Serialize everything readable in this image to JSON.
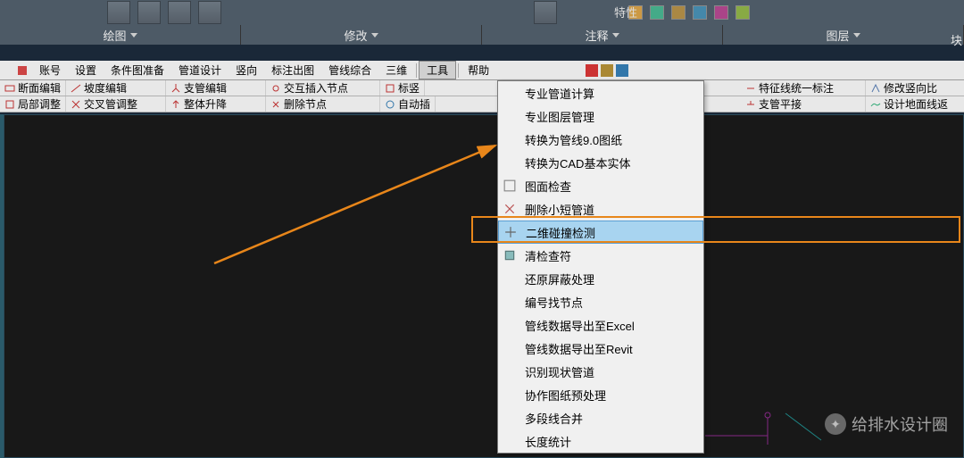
{
  "props_label": "特性",
  "category": {
    "c1": "绘图",
    "c2": "修改",
    "c3": "注释",
    "c4": "图层",
    "c5": "块"
  },
  "menu": {
    "m1": "账号",
    "m2": "设置",
    "m3": "条件图准备",
    "m4": "管道设计",
    "m5": "竖向",
    "m6": "标注出图",
    "m7": "管线综合",
    "m8": "三维",
    "m9": "工具",
    "m10": "帮助"
  },
  "toolbar1": {
    "t1": "断面编辑",
    "t2": "坡度编辑",
    "t3": "支管编辑",
    "t4": "交互插入节点",
    "t5": "标竖",
    "t6": "特征线统一标注",
    "t7": "修改竖向比"
  },
  "toolbar2": {
    "t1": "局部调整",
    "t2": "交叉管调整",
    "t3": "整体升降",
    "t4": "删除节点",
    "t5": "自动插",
    "t6": "支管平接",
    "t7": "设计地面线返"
  },
  "dropdown": {
    "d1": "专业管道计算",
    "d2": "专业图层管理",
    "d3": "转换为管线9.0图纸",
    "d4": "转换为CAD基本实体",
    "d5": "图面检查",
    "d6": "删除小短管道",
    "d7": "二维碰撞检测",
    "d8": "清检查符",
    "d9": "还原屏蔽处理",
    "d10": "编号找节点",
    "d11": "管线数据导出至Excel",
    "d12": "管线数据导出至Revit",
    "d13": "识别现状管道",
    "d14": "协作图纸预处理",
    "d15": "多段线合并",
    "d16": "长度统计"
  },
  "watermark": "给排水设计圈"
}
